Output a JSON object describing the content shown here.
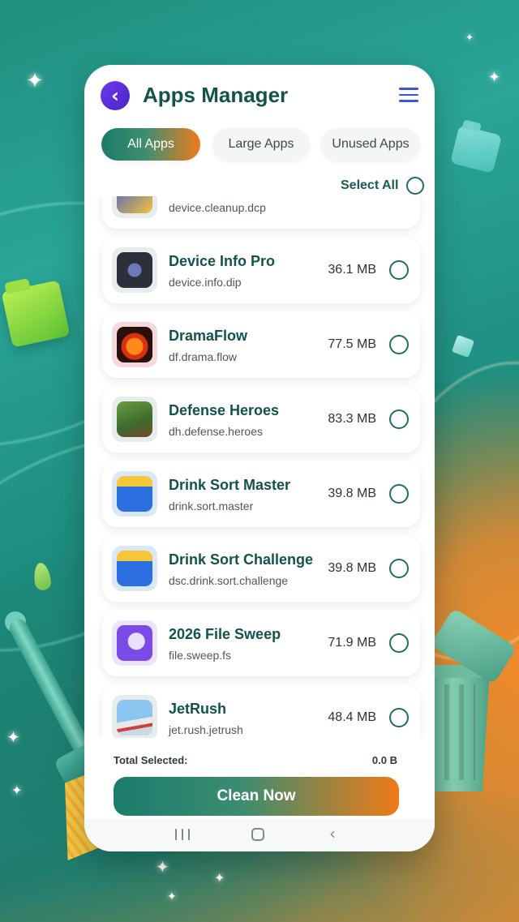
{
  "header": {
    "title": "Apps Manager",
    "back_icon": "chevron-left-icon",
    "menu_icon": "hamburger-menu-icon"
  },
  "tabs": [
    {
      "label": "All Apps",
      "active": true
    },
    {
      "label": "Large Apps",
      "active": false
    },
    {
      "label": "Unused Apps",
      "active": false
    }
  ],
  "select_all": {
    "label": "Select All",
    "checked": false
  },
  "apps": [
    {
      "name": "",
      "package": "device.cleanup.dcp",
      "size": "",
      "icon": "cleanup-app-icon",
      "icon_color": "#3f5bd4"
    },
    {
      "name": "Device Info Pro",
      "package": "device.info.dip",
      "size": "36.1 MB",
      "icon": "chip-app-icon",
      "icon_color": "#2b2f3a"
    },
    {
      "name": "DramaFlow",
      "package": "df.drama.flow",
      "size": "77.5 MB",
      "icon": "flame-app-icon",
      "icon_color": "#2a0f0c"
    },
    {
      "name": "Defense Heroes",
      "package": "dh.defense.heroes",
      "size": "83.3 MB",
      "icon": "game-heroes-app-icon",
      "icon_color": "#3d6b2e"
    },
    {
      "name": "Drink Sort Master",
      "package": "drink.sort.master",
      "size": "39.8 MB",
      "icon": "puzzle-app-icon",
      "icon_color": "#2b6fe0"
    },
    {
      "name": "Drink Sort Challenge",
      "package": "dsc.drink.sort.challenge",
      "size": "39.8 MB",
      "icon": "puzzle-app-icon",
      "icon_color": "#2b6fe0"
    },
    {
      "name": "2026 File Sweep",
      "package": "file.sweep.fs",
      "size": "71.9 MB",
      "icon": "file-sweep-app-icon",
      "icon_color": "#7b4be8"
    },
    {
      "name": "JetRush",
      "package": "jet.rush.jetrush",
      "size": "48.4 MB",
      "icon": "jet-game-app-icon",
      "icon_color": "#6fb3e8"
    }
  ],
  "footer": {
    "total_label": "Total Selected:",
    "total_value": "0.0 B",
    "clean_button": "Clean Now"
  },
  "colors": {
    "primary_teal": "#15524c",
    "accent_orange": "#f07a18",
    "back_button_purple": "#5a2ee0",
    "menu_blue": "#3b57d8"
  }
}
